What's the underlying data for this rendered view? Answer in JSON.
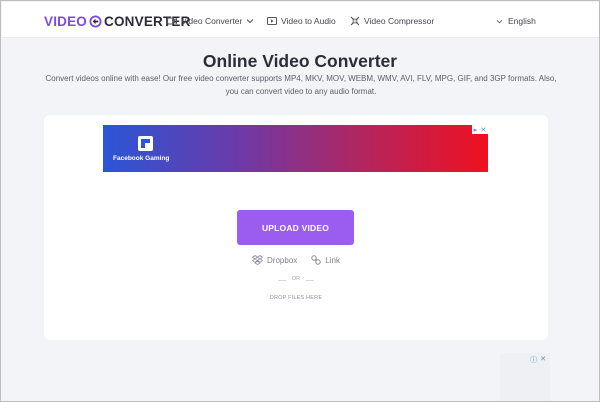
{
  "header": {
    "logo_part1": "VIDEO",
    "logo_part2": "CONVERTER",
    "nav": [
      {
        "label": "Video Converter",
        "icon": "video-camera-icon",
        "has_dropdown": true
      },
      {
        "label": "Video to Audio",
        "icon": "play-icon"
      },
      {
        "label": "Video Compressor",
        "icon": "compress-icon"
      }
    ],
    "language": "English"
  },
  "hero": {
    "title": "Online Video Converter",
    "subtitle": "Convert videos online with ease! Our free video converter supports MP4, MKV, MOV, WEBM, WMV, AVI, FLV, MPG, GIF, and 3GP formats. Also, you can convert video to any audio format."
  },
  "ad": {
    "brand": "Facebook Gaming"
  },
  "upload": {
    "button_label": "UPLOAD VIDEO",
    "sources": [
      {
        "label": "Dropbox",
        "icon": "dropbox-icon"
      },
      {
        "label": "Link",
        "icon": "link-icon"
      }
    ],
    "or_label": "OR",
    "drop_label": "DROP FILES HERE"
  },
  "colors": {
    "accent": "#9b5cf0",
    "logo_accent": "#7c4be0",
    "background": "#f3f4f7"
  }
}
